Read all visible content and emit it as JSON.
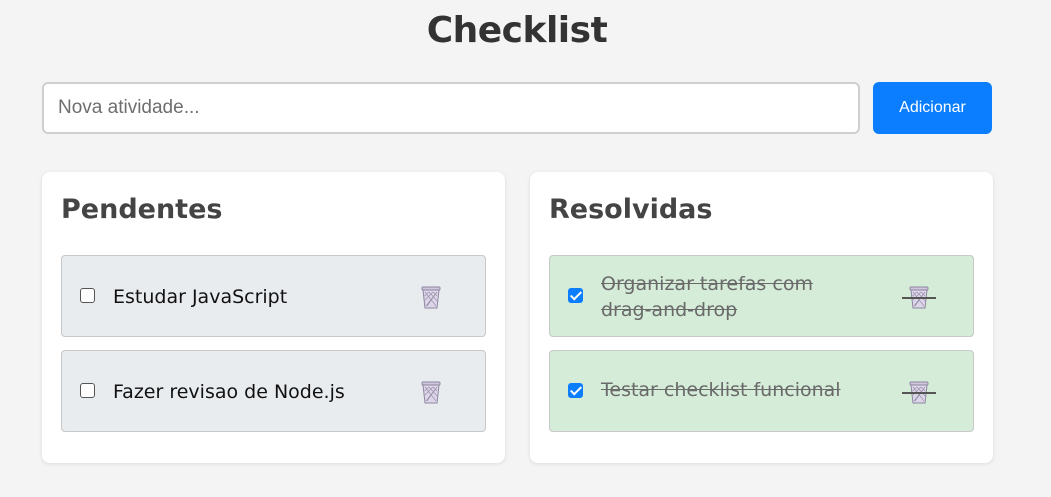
{
  "header": {
    "title": "Checklist"
  },
  "new_task": {
    "placeholder": "Nova atividade...",
    "value": "",
    "button_label": "Adicionar"
  },
  "pending": {
    "title": "Pendentes",
    "items": [
      {
        "text": "Estudar JavaScript",
        "checked": false,
        "icon": "trash-icon"
      },
      {
        "text": "Fazer revisao de Node.js",
        "checked": false,
        "icon": "trash-icon"
      }
    ]
  },
  "resolved": {
    "title": "Resolvidas",
    "items": [
      {
        "text": "Organizar tarefas com drag-and-drop",
        "checked": true,
        "icon": "trash-icon"
      },
      {
        "text": "Testar checklist funcional",
        "checked": true,
        "icon": "trash-icon"
      }
    ]
  },
  "colors": {
    "accent": "#0a7eff",
    "pending_item_bg": "#e9ecef",
    "resolved_item_bg": "#d4ecd8",
    "page_bg": "#f4f4f4"
  }
}
